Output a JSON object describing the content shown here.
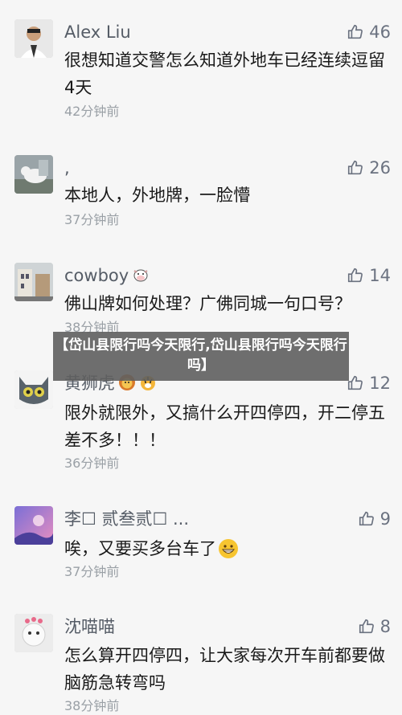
{
  "comments": [
    {
      "name": "Alex Liu",
      "likes": "46",
      "text": "很想知道交警怎么知道外地车已经连续逗留4天",
      "time": "42分钟前"
    },
    {
      "name": ",",
      "likes": "26",
      "text": "本地人，外地牌，一脸懵",
      "time": "37分钟前"
    },
    {
      "name": "cowboy",
      "likes": "14",
      "text": "佛山牌如何处理？广佛同城一句口号？",
      "time": "38分钟前"
    },
    {
      "name": "黄狮虎",
      "likes": "12",
      "text": "限外就限外，又搞什么开四停四，开二停五差不多！！！",
      "time": "36分钟前"
    },
    {
      "name": "李☐ 贰叁贰☐ ...",
      "likes": "9",
      "text": "唉，又要买多台车了",
      "time": "37分钟前"
    },
    {
      "name": "沈喵喵",
      "likes": "8",
      "text": "怎么算开四停四，让大家每次开车前都要做脑筋急转弯吗",
      "time": "38分钟前"
    }
  ],
  "overlay": {
    "title": "【岱山县限行吗今天限行,岱山县限行吗今天限行吗】"
  },
  "icons": {
    "like": "thumbs-up-icon"
  },
  "colors": {
    "background": "#f6f6f6",
    "overlay": "#5f5f5f",
    "name": "#555c66",
    "time": "#9aa0a6"
  }
}
